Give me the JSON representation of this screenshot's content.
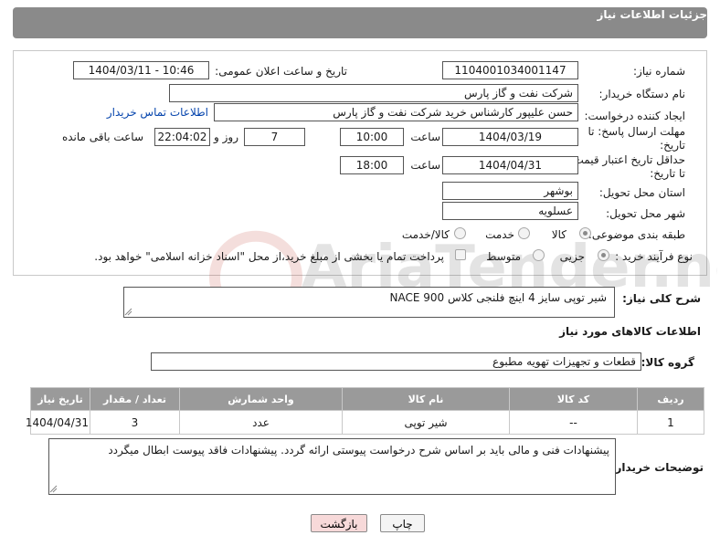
{
  "header": {
    "title": "جزئیات اطلاعات نیاز"
  },
  "form": {
    "need_number_label": "شماره نیاز:",
    "need_number": "1104001034001147",
    "announce_label": "تاریخ و ساعت اعلان عمومی:",
    "announce_value": "1404/03/11 - 10:46",
    "buyer_org_label": "نام دستگاه خریدار:",
    "buyer_org": "شرکت نفت و گاز پارس",
    "creator_label": "ایجاد کننده درخواست:",
    "creator": "حسن علیپور کارشناس خرید شرکت نفت و گاز پارس",
    "contact_link": "اطلاعات تماس خریدار",
    "reply_deadline_label": "مهلت ارسال پاسخ: تا تاریخ:",
    "reply_date": "1404/03/19",
    "time_label": "ساعت",
    "reply_time": "10:00",
    "days": "7",
    "days_label": "روز و",
    "remaining_time": "22:04:02",
    "remaining_label": "ساعت باقی مانده",
    "validity_label": "حداقل تاریخ اعتبار قیمت: تا تاریخ:",
    "validity_date": "1404/04/31",
    "validity_time": "18:00",
    "province_label": "استان محل تحویل:",
    "province": "بوشهر",
    "city_label": "شهر محل تحویل:",
    "city": "عسلویه",
    "category_label": "طبقه بندی موضوعی:",
    "category_options": [
      "کالا",
      "خدمت",
      "کالا/خدمت"
    ],
    "process_label": "نوع فرآیند خرید :",
    "process_options": [
      "جزیی",
      "متوسط"
    ],
    "payment_note": "پرداخت تمام یا بخشی از مبلغ خرید،از محل \"اسناد خزانه اسلامی\" خواهد بود."
  },
  "summary": {
    "label": "شرح کلی نیاز:",
    "value": "شیر توپی سایز 4 اینچ فلنجی کلاس  NACE 900"
  },
  "goods": {
    "section_title": "اطلاعات کالاهای مورد نیاز",
    "group_label": "گروه کالا:",
    "group_value": "قطعات و تجهیزات تهویه مطبوع"
  },
  "table": {
    "headers": [
      "ردیف",
      "کد کالا",
      "نام کالا",
      "واحد شمارش",
      "تعداد / مقدار",
      "تاریخ نیاز"
    ],
    "rows": [
      [
        "1",
        "--",
        "شیر توپی",
        "عدد",
        "3",
        "1404/04/31"
      ]
    ]
  },
  "buyer_notes": {
    "label": "توضیحات خریدار:",
    "value": "پیشنهادات فنی و مالی باید بر اساس شرح درخواست پیوستی ارائه گردد. پیشنهادات فاقد پیوست ابطال میگردد"
  },
  "buttons": {
    "print": "چاپ",
    "back": "بازگشت"
  },
  "watermark": {
    "text": "AriaTender.neT"
  },
  "colors": {
    "header_bg": "#8a8a8a",
    "link": "#0645ad",
    "back_btn_bg": "#f7d9d9"
  }
}
